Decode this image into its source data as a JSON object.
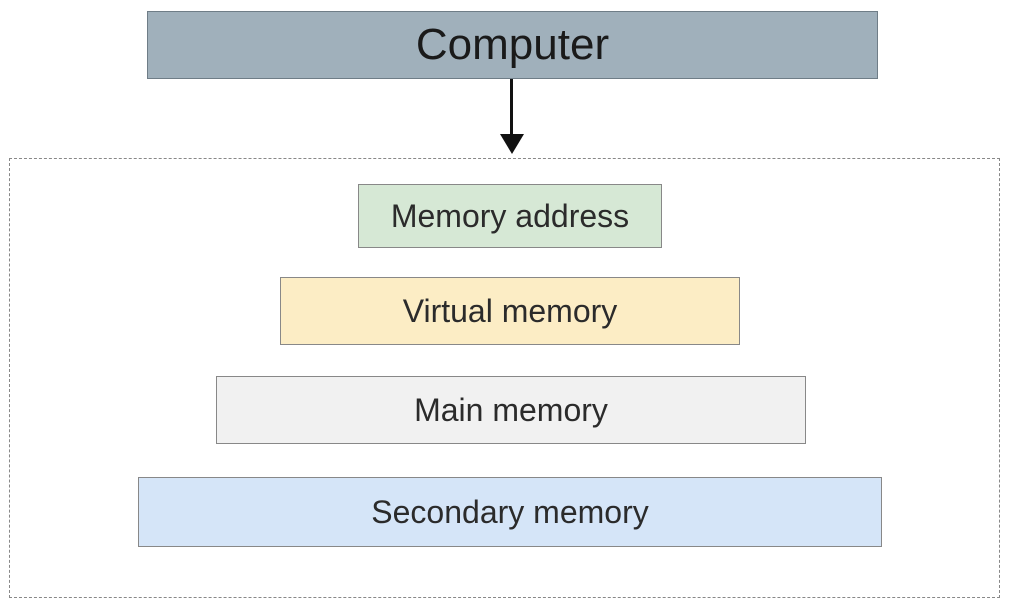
{
  "diagram": {
    "root": {
      "label": "Computer",
      "color": "#a0b0bb"
    },
    "group": {
      "tiers": [
        {
          "label": "Memory address",
          "color": "#d6e8d5"
        },
        {
          "label": "Virtual memory",
          "color": "#fcedc5"
        },
        {
          "label": "Main memory",
          "color": "#f1f1f1"
        },
        {
          "label": "Secondary memory",
          "color": "#d5e5f8"
        }
      ]
    }
  }
}
